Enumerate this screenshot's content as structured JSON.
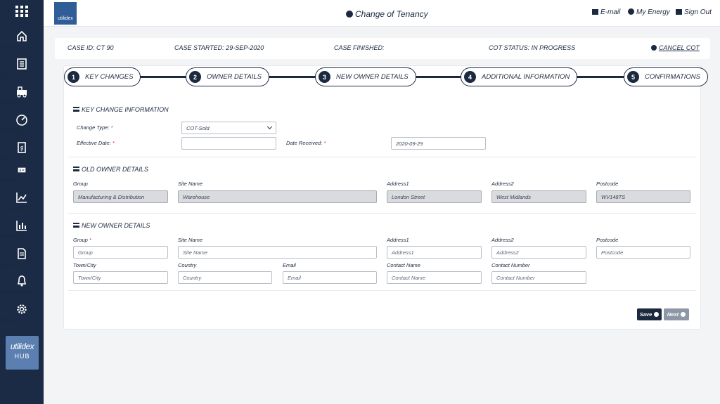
{
  "sidebar": {
    "items": [
      {
        "label": "Home",
        "icon": "home-icon"
      },
      {
        "label": "Sites",
        "icon": "sites-icon"
      },
      {
        "label": "Tasks",
        "icon": "tasks-icon"
      },
      {
        "label": "Metering",
        "icon": "metering-icon"
      },
      {
        "label": "Bills",
        "icon": "bills-icon"
      },
      {
        "label": "Rates",
        "icon": "rates-icon"
      },
      {
        "label": "Forecasting",
        "icon": "forecasting-icon"
      },
      {
        "label": "Market Data",
        "icon": "market-data-icon"
      },
      {
        "label": "Reports",
        "icon": "reports-icon"
      },
      {
        "label": "Notifications",
        "icon": "bell-icon"
      },
      {
        "label": "Settings",
        "icon": "gear-icon"
      }
    ],
    "hub_logo": {
      "line1": "utilidex",
      "line2": "HUB"
    }
  },
  "topbar": {
    "brand": "utilidex",
    "title": "Change of Tenancy",
    "links": {
      "email": "E-mail",
      "my_energy": "My Energy",
      "sign_out": "Sign Out"
    }
  },
  "case": {
    "id": "CASE ID: CT 90",
    "started": "CASE STARTED: 29-SEP-2020",
    "finished": "CASE FINISHED:",
    "status": "COT STATUS: IN PROGRESS",
    "cancel": "CANCEL COT"
  },
  "steps": [
    {
      "num": "1",
      "label": "KEY CHANGES"
    },
    {
      "num": "2",
      "label": "OWNER DETAILS"
    },
    {
      "num": "3",
      "label": "NEW OWNER DETAILS"
    },
    {
      "num": "4",
      "label": "ADDITIONAL INFORMATION"
    },
    {
      "num": "5",
      "label": "CONFIRMATIONS"
    }
  ],
  "key_change": {
    "title": "KEY CHANGE INFORMATION",
    "change_type_label": "Change Type:",
    "change_type_value": "COT-Sold",
    "effective_date_label": "Effective Date:",
    "effective_date_value": "",
    "date_received_label": "Date Received:",
    "date_received_value": "2020-09-29"
  },
  "old_owner": {
    "title": "OLD OWNER DETAILS",
    "labels": {
      "group": "Group",
      "site_name": "Site Name",
      "address1": "Address1",
      "address2": "Address2",
      "postcode": "Postcode"
    },
    "values": {
      "group": "Manufacturing & Distribution",
      "site_name": "Warehouse",
      "address1": "London Street",
      "address2": "West Midlands",
      "postcode": "WV148TS"
    }
  },
  "new_owner": {
    "title": "NEW OWNER DETAILS",
    "labels": {
      "group": "Group",
      "site_name": "Site Name",
      "address1": "Address1",
      "address2": "Address2",
      "postcode": "Postcode",
      "town": "Town/City",
      "country": "Country",
      "email": "Email",
      "contact_name": "Contact Name",
      "contact_number": "Contact Number"
    },
    "placeholders": {
      "group": "Group",
      "site_name": "Site Name",
      "address1": "Address1",
      "address2": "Address2",
      "postcode": "Postcode",
      "town": "Town/City",
      "country": "Country",
      "email": "Email",
      "contact_name": "Contact Name",
      "contact_number": "Contact Number"
    }
  },
  "actions": {
    "save": "Save",
    "next": "Next"
  },
  "colors": {
    "sidebar": "#1b2a45",
    "accent": "#1c2a3f",
    "required": "#d0302b",
    "next_button": "#8e97a6"
  }
}
